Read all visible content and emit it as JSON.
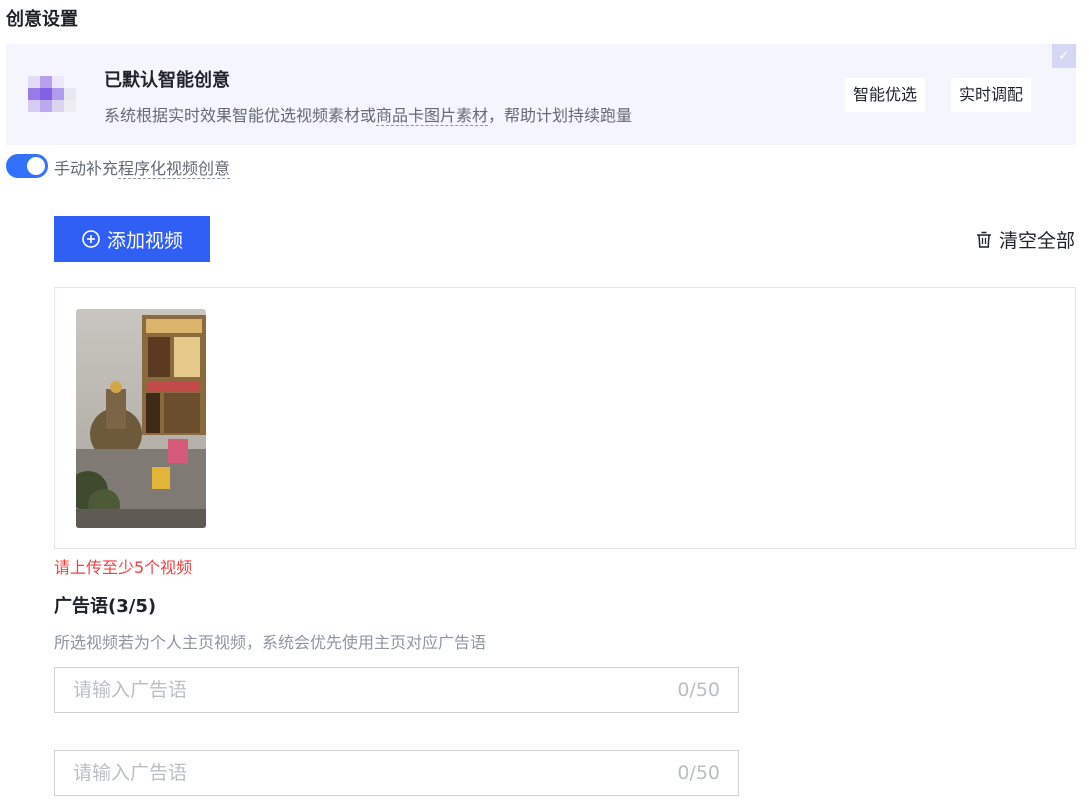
{
  "section_title": "创意设置",
  "smart_creative": {
    "title": "已默认智能创意",
    "desc_before": "系统根据实时效果智能优选视频素材或",
    "desc_dashed": "商品卡图片素材",
    "desc_after": "，帮助计划持续跑量",
    "tags": [
      "智能优选",
      "实时调配"
    ],
    "checked": true
  },
  "toggle": {
    "on": true,
    "label_prefix": "手动补充",
    "label_dashed": "程序化视频创意"
  },
  "toolbar": {
    "add_video_label": "添加视频",
    "clear_all_label": "清空全部"
  },
  "error_message": "请上传至少5个视频",
  "ad_copy": {
    "title": "广告语(3/5)",
    "desc": "所选视频若为个人主页视频，系统会优先使用主页对应广告语",
    "inputs": [
      {
        "placeholder": "请输入广告语",
        "value": "",
        "counter": "0/50"
      },
      {
        "placeholder": "请输入广告语",
        "value": "",
        "counter": "0/50"
      }
    ]
  },
  "colors": {
    "primary": "#2f5ff5",
    "toggle_on": "#3370ff",
    "error": "#f53f3f",
    "card_bg": "#f5f5fd"
  }
}
